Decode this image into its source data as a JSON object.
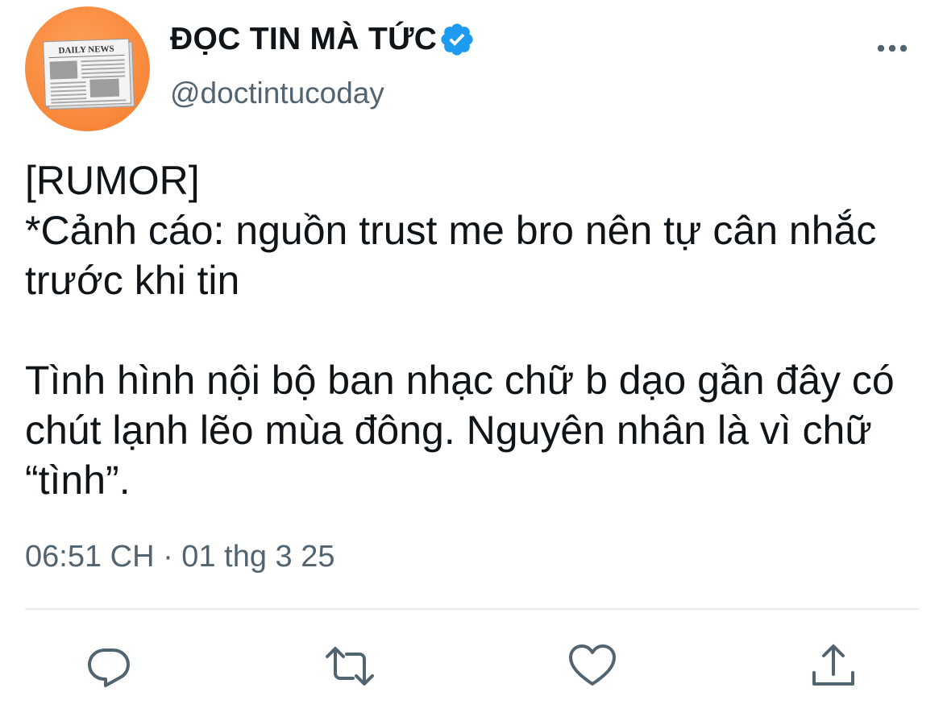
{
  "account": {
    "display_name": "ĐỌC TIN MÀ TỨC",
    "handle": "@doctintucoday",
    "verified": true,
    "avatar_text": "DAILY NEWS"
  },
  "tweet": {
    "text": "[RUMOR]\n*Cảnh cáo: nguồn trust me bro nên tự cân nhắc trước khi tin\n\nTình hình nội bộ ban nhạc chữ b dạo gần đây có chút lạnh lẽo mùa đông. Nguyên nhân là vì chữ “tình”.",
    "timestamp": "06:51 CH · 01 thg 3 25"
  },
  "icons": {
    "more": "more-icon",
    "verified": "verified-badge-icon",
    "reply": "reply-icon",
    "retweet": "retweet-icon",
    "like": "like-icon",
    "share": "share-icon"
  },
  "colors": {
    "accent": "#1d9bf0",
    "secondary_text": "#536471",
    "avatar_orange": "#f98b3e"
  }
}
